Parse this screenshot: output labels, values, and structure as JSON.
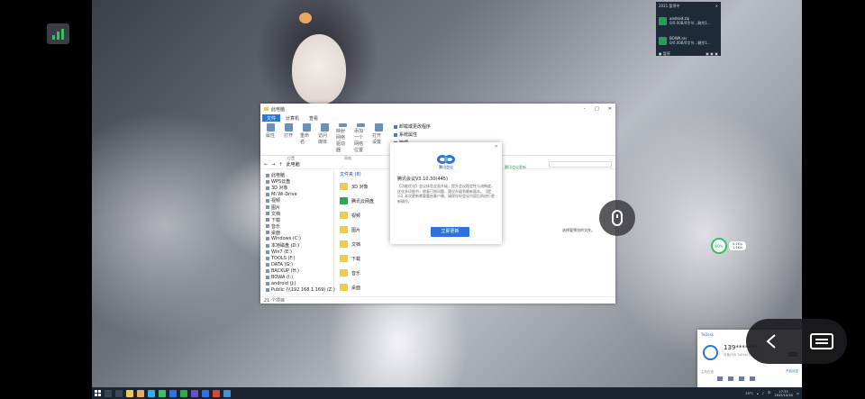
{
  "transfer_panel": {
    "header": "2021.暂停中",
    "items": [
      {
        "name": "android.zip",
        "meta": "0/0.00B/0字节...剩余1..."
      },
      {
        "name": "BOWA.rar",
        "meta": "0/0.00B/0字节...剩余1..."
      }
    ],
    "footer_left": "● 暂停",
    "footer_right": "▣ ▣ ▣"
  },
  "explorer": {
    "title": "此电脑",
    "tabs": [
      "文件",
      "计算机",
      "查看"
    ],
    "ribbon_buttons": [
      "属性",
      "打开",
      "重命名",
      "访问媒体",
      "映射网络驱动器",
      "添加一个网络位置",
      "打开设置"
    ],
    "ribbon_groups": [
      "位置",
      "网络",
      "系统"
    ],
    "ribbon_side": [
      "卸载或更改程序",
      "系统属性",
      "管理"
    ],
    "address": "此电脑",
    "nav_items": [
      "此电脑",
      "WPS云盘",
      "3D 对象",
      "Mi Wi-Drive",
      "视频",
      "图片",
      "文档",
      "下载",
      "音乐",
      "桌面",
      "Windows (C:)",
      "本地磁盘 (D:)",
      "Win7 (E:)",
      "TOOLS (F:)",
      "DATA (G:)",
      "BACKUP (H:)",
      "BOWA (I:)",
      "android (J:)",
      "Public (\\\\192.168.1.169) (Z:)"
    ],
    "content_group": "文件夹 (8)",
    "files": [
      "3D 对象",
      "腾讯云网盘",
      "视频",
      "图片",
      "文档",
      "下载",
      "音乐",
      "桌面"
    ],
    "status": "21 个项目"
  },
  "dialog": {
    "close": "✕",
    "brand": "腾讯会议",
    "version": "腾讯会议V3.10.30(445)",
    "note": "【功能优化】会议体验全面升级，提升会议稳定性与流畅度，优化多项细节，修复已知问题，建议升级到最新版本。【提示】本次更新需要重启客户端，请保存好会议内容后再进行更新操作。",
    "button": "立即更新"
  },
  "hints": {
    "side": "选择要预览的文件。",
    "green": "腾讯会议更新"
  },
  "netspeed": {
    "value": "60%",
    "up": "0.4K/s",
    "down": "1.5K/s"
  },
  "todesk": {
    "brand": "ToDesk",
    "phone": "139*******",
    "sub": "设备代码 ToDesk已连接",
    "status": "主机在线",
    "online": "开启远控"
  },
  "taskbar": {
    "tray_text": "中",
    "weather": "25°C",
    "time": "17:33",
    "date": "2023/10/18"
  }
}
